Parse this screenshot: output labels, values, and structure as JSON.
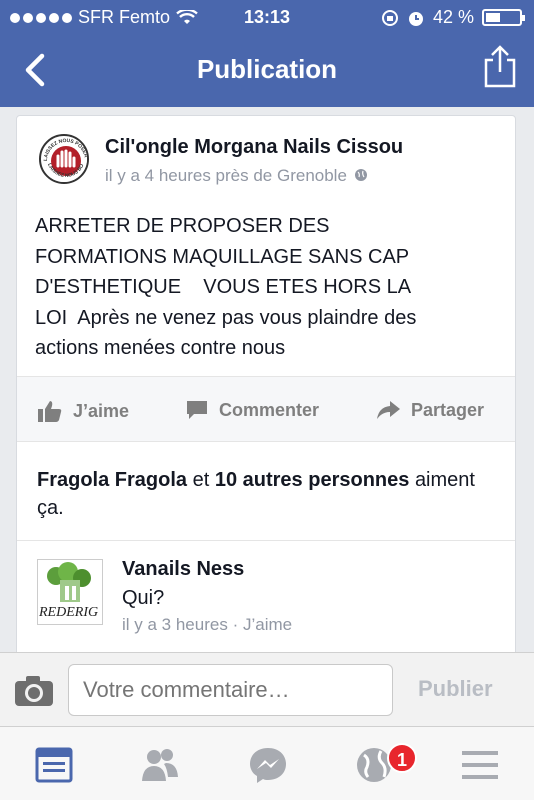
{
  "status_bar": {
    "carrier": "SFR Femto",
    "time": "13:13",
    "battery": "42 %"
  },
  "nav": {
    "title": "Publication"
  },
  "post": {
    "author": "Cil'ongle Morgana Nails Cissou",
    "meta": "il y a 4 heures près de Grenoble",
    "text": "ARRETER DE PROPOSER DES\nFORMATIONS MAQUILLAGE SANS CAP\nD'ESTHETIQUE    VOUS ETES HORS LA\nLOI  Après ne venez pas vous plaindre des\nactions menées contre nous",
    "avatar_text_top": "LAISSEZ NOUS POSER",
    "avatar_text_bottom": "LAISSEZ NOUS BOSSER !"
  },
  "actions": {
    "like": "J’aime",
    "comment": "Commenter",
    "share": "Partager"
  },
  "likes": {
    "name": "Fragola Fragola",
    "connector": "et",
    "others": "10 autres personnes",
    "suffix": "aiment ça."
  },
  "comment": {
    "author": "Vanails Ness",
    "text": "Qui?",
    "time": "il y a 3 heures",
    "separator": "·",
    "like": "J’aime",
    "avatar_logo": "REDERIG"
  },
  "composer": {
    "placeholder": "Votre commentaire…",
    "publish": "Publier"
  },
  "tabs": {
    "notifications_badge": "1"
  },
  "colors": {
    "brand": "#4a67ad",
    "badge": "#e8262d"
  },
  "icons": [
    "signal-dots",
    "wifi-icon",
    "rotation-lock-icon",
    "alarm-icon",
    "battery-icon",
    "back-icon",
    "share-icon",
    "globe-icon",
    "like-icon",
    "comment-icon",
    "share-arrow-icon",
    "camera-icon",
    "news-feed-icon",
    "friends-icon",
    "messenger-icon",
    "notifications-icon",
    "menu-icon"
  ]
}
